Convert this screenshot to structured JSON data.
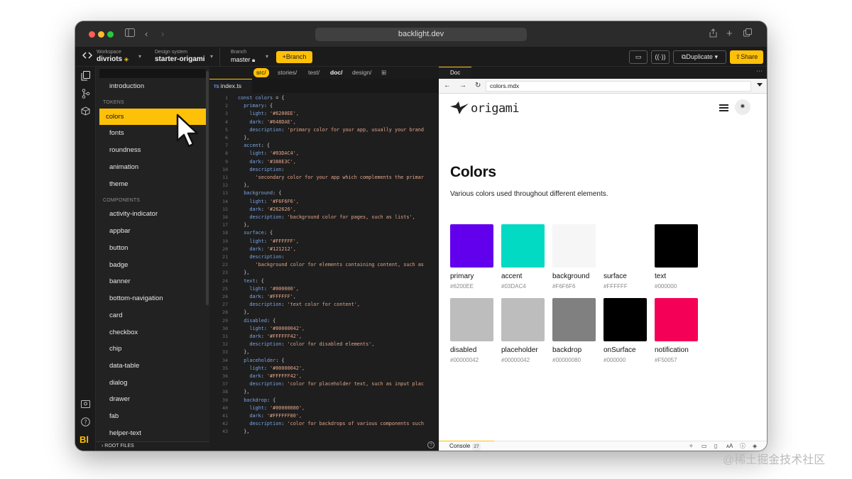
{
  "browser": {
    "url": "backlight.dev"
  },
  "header": {
    "workspace_label": "Workspace",
    "workspace_value": "divriots",
    "design_system_label": "Design system",
    "design_system_value": "starter-origami",
    "branch_label": "Branch",
    "branch_value": "master",
    "branch_button": "+Branch",
    "duplicate_button": "Duplicate",
    "share_button": "Share"
  },
  "sidebar": {
    "items_top": [
      {
        "label": "introduction"
      }
    ],
    "tokens_heading": "TOKENS",
    "tokens": [
      {
        "label": "colors",
        "active": true
      },
      {
        "label": "fonts"
      },
      {
        "label": "roundness"
      },
      {
        "label": "animation"
      },
      {
        "label": "theme"
      }
    ],
    "components_heading": "COMPONENTS",
    "components": [
      {
        "label": "activity-indicator"
      },
      {
        "label": "appbar"
      },
      {
        "label": "button"
      },
      {
        "label": "badge"
      },
      {
        "label": "banner"
      },
      {
        "label": "bottom-navigation"
      },
      {
        "label": "card"
      },
      {
        "label": "checkbox"
      },
      {
        "label": "chip"
      },
      {
        "label": "data-table"
      },
      {
        "label": "dialog"
      },
      {
        "label": "drawer"
      },
      {
        "label": "fab"
      },
      {
        "label": "helper-text"
      }
    ],
    "root_files": "ROOT FILES"
  },
  "editor": {
    "breadcrumbs": [
      "src/",
      "stories/",
      "test/",
      "doc/",
      "design/"
    ],
    "tab_label": "index.ts",
    "tab_lang": "TS",
    "line_numbers": [
      "1",
      "2",
      "3",
      "4",
      "5",
      "6",
      "7",
      "8",
      "9",
      "10",
      "11",
      "12",
      "13",
      "14",
      "15",
      "16",
      "17",
      "18",
      "19",
      "20",
      "21",
      "22",
      "23",
      "24",
      "25",
      "26",
      "27",
      "28",
      "29",
      "30",
      "31",
      "32",
      "33",
      "34",
      "35",
      "36",
      "37",
      "38",
      "39",
      "40",
      "41",
      "42",
      "43"
    ],
    "lines": [
      {
        "indent": "",
        "key": "const colors",
        "rest": " = {"
      },
      {
        "indent": "  ",
        "key": "primary",
        "rest": ": {"
      },
      {
        "indent": "    ",
        "key": "light",
        "rest": ": ",
        "str": "'#6200EE',"
      },
      {
        "indent": "    ",
        "key": "dark",
        "rest": ": ",
        "str": "'#648DAE',"
      },
      {
        "indent": "    ",
        "key": "description",
        "rest": ": ",
        "str": "'primary color for your app, usually your brand"
      },
      {
        "indent": "  ",
        "key": "",
        "rest": "},"
      },
      {
        "indent": "  ",
        "key": "accent",
        "rest": ": {"
      },
      {
        "indent": "    ",
        "key": "light",
        "rest": ": ",
        "str": "'#03DAC4',"
      },
      {
        "indent": "    ",
        "key": "dark",
        "rest": ": ",
        "str": "'#388E3C',"
      },
      {
        "indent": "    ",
        "key": "description",
        "rest": ":"
      },
      {
        "indent": "      ",
        "key": "",
        "rest": "",
        "str": "'secondary color for your app which complements the primar"
      },
      {
        "indent": "  ",
        "key": "",
        "rest": "},"
      },
      {
        "indent": "  ",
        "key": "background",
        "rest": ": {"
      },
      {
        "indent": "    ",
        "key": "light",
        "rest": ": ",
        "str": "'#F6F6F6',"
      },
      {
        "indent": "    ",
        "key": "dark",
        "rest": ": ",
        "str": "'#262626',"
      },
      {
        "indent": "    ",
        "key": "description",
        "rest": ": ",
        "str": "'background color for pages, such as lists',"
      },
      {
        "indent": "  ",
        "key": "",
        "rest": "},"
      },
      {
        "indent": "  ",
        "key": "surface",
        "rest": ": {"
      },
      {
        "indent": "    ",
        "key": "light",
        "rest": ": ",
        "str": "'#FFFFFF',"
      },
      {
        "indent": "    ",
        "key": "dark",
        "rest": ": ",
        "str": "'#121212',"
      },
      {
        "indent": "    ",
        "key": "description",
        "rest": ":"
      },
      {
        "indent": "      ",
        "key": "",
        "rest": "",
        "str": "'background color for elements containing content, such as"
      },
      {
        "indent": "  ",
        "key": "",
        "rest": "},"
      },
      {
        "indent": "  ",
        "key": "text",
        "rest": ": {"
      },
      {
        "indent": "    ",
        "key": "light",
        "rest": ": ",
        "str": "'#000000',"
      },
      {
        "indent": "    ",
        "key": "dark",
        "rest": ": ",
        "str": "'#FFFFFF',"
      },
      {
        "indent": "    ",
        "key": "description",
        "rest": ": ",
        "str": "'text color for content',"
      },
      {
        "indent": "  ",
        "key": "",
        "rest": "},"
      },
      {
        "indent": "  ",
        "key": "disabled",
        "rest": ": {"
      },
      {
        "indent": "    ",
        "key": "light",
        "rest": ": ",
        "str": "'#00000042',"
      },
      {
        "indent": "    ",
        "key": "dark",
        "rest": ": ",
        "str": "'#FFFFFF42',"
      },
      {
        "indent": "    ",
        "key": "description",
        "rest": ": ",
        "str": "'color for disabled elements',"
      },
      {
        "indent": "  ",
        "key": "",
        "rest": "},"
      },
      {
        "indent": "  ",
        "key": "placeholder",
        "rest": ": {"
      },
      {
        "indent": "    ",
        "key": "light",
        "rest": ": ",
        "str": "'#00000042',"
      },
      {
        "indent": "    ",
        "key": "dark",
        "rest": ": ",
        "str": "'#FFFFFF42',"
      },
      {
        "indent": "    ",
        "key": "description",
        "rest": ": ",
        "str": "'color for placeholder text, such as input plac"
      },
      {
        "indent": "  ",
        "key": "",
        "rest": "},"
      },
      {
        "indent": "  ",
        "key": "backdrop",
        "rest": ": {"
      },
      {
        "indent": "    ",
        "key": "light",
        "rest": ": ",
        "str": "'#00000080',"
      },
      {
        "indent": "    ",
        "key": "dark",
        "rest": ": ",
        "str": "'#FFFFFF80',"
      },
      {
        "indent": "    ",
        "key": "description",
        "rest": ": ",
        "str": "'color for backdrops of various components such"
      },
      {
        "indent": "  ",
        "key": "",
        "rest": "},"
      }
    ]
  },
  "preview": {
    "tab_label": "Doc",
    "url": "colors.mdx",
    "brand": "origami",
    "title": "Colors",
    "description": "Various colors used throughout different elements.",
    "swatches": [
      {
        "name": "primary",
        "hex": "#6200EE",
        "color": "#6200EE"
      },
      {
        "name": "accent",
        "hex": "#03DAC4",
        "color": "#03DAC4"
      },
      {
        "name": "background",
        "hex": "#F6F6F6",
        "color": "#F6F6F6"
      },
      {
        "name": "surface",
        "hex": "#FFFFFF",
        "color": "#FFFFFF"
      },
      {
        "name": "text",
        "hex": "#000000",
        "color": "#000000"
      },
      {
        "name": "disabled",
        "hex": "#00000042",
        "color": "#BDBDBD"
      },
      {
        "name": "placeholder",
        "hex": "#00000042",
        "color": "#BDBDBD"
      },
      {
        "name": "backdrop",
        "hex": "#00000080",
        "color": "#808080"
      },
      {
        "name": "onSurface",
        "hex": "#000000",
        "color": "#000000"
      },
      {
        "name": "notification",
        "hex": "#F50057",
        "color": "#F50057"
      }
    ],
    "console_label": "Console",
    "console_count": "27"
  },
  "colors": {
    "accent": "#ffc107"
  },
  "watermark": "@稀土掘金技术社区"
}
